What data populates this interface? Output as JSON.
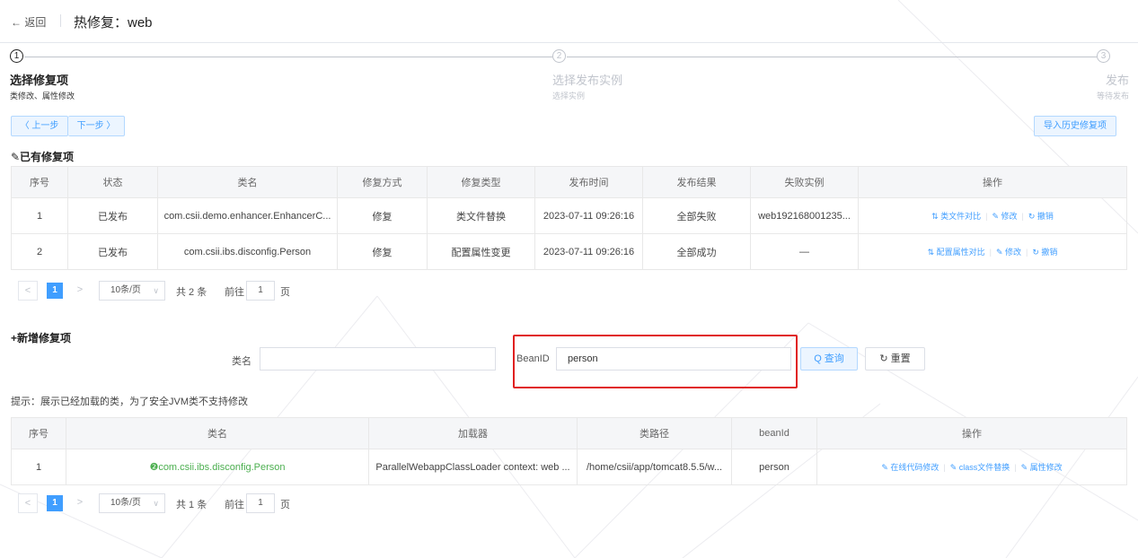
{
  "header": {
    "back_label": "← 返回",
    "title": "热修复：web"
  },
  "steps": [
    {
      "num": "1",
      "title": "选择修复项",
      "desc": "类修改、属性修改"
    },
    {
      "num": "2",
      "title": "选择发布实例",
      "desc": "选择实例"
    },
    {
      "num": "3",
      "title": "发布",
      "desc": "等待发布"
    }
  ],
  "nav": {
    "prev_label": "〈 上一步",
    "next_label": "下一步 〉",
    "import_label": "导入历史修复项"
  },
  "existing": {
    "title": "✎已有修复项",
    "columns": [
      "序号",
      "状态",
      "类名",
      "修复方式",
      "修复类型",
      "发布时间",
      "发布结果",
      "失败实例",
      "操作"
    ],
    "rows": [
      {
        "idx": "1",
        "status": "已发布",
        "class": "com.csii.demo.enhancer.EnhancerC...",
        "method": "修复",
        "type": "类文件替换",
        "time": "2023-07-11 09:26:16",
        "result": "全部失败",
        "failed": "web192168001235...",
        "op1": "⇅ 类文件对比",
        "op2": "✎ 修改",
        "op3": "↻ 撤销"
      },
      {
        "idx": "2",
        "status": "已发布",
        "class": "com.csii.ibs.disconfig.Person",
        "method": "修复",
        "type": "配置属性变更",
        "time": "2023-07-11 09:26:16",
        "result": "全部成功",
        "failed": "—",
        "op1": "⇅ 配置属性对比",
        "op2": "✎ 修改",
        "op3": "↻ 撤销"
      }
    ],
    "pager": {
      "prev": "<",
      "current": "1",
      "next": ">",
      "size": "10条/页",
      "caret": "∨",
      "total": "共 2 条",
      "goto": "前往",
      "page": "1",
      "unit": "页"
    }
  },
  "add": {
    "title": "+新增修复项",
    "class_label": "类名",
    "class_value": "",
    "bean_label": "BeanID",
    "bean_value": "person",
    "search_label": "Q 查询",
    "reset_label": "↻ 重置"
  },
  "hint": "提示：展示已经加载的类，为了安全JVM类不支持修改",
  "loaded": {
    "columns": [
      "序号",
      "类名",
      "加载器",
      "类路径",
      "beanId",
      "操作"
    ],
    "rows": [
      {
        "idx": "1",
        "class": "❷com.csii.ibs.disconfig.Person",
        "loader": "ParallelWebappClassLoader context: web ...",
        "path": "/home/csii/app/tomcat8.5.5/w...",
        "bean": "person",
        "op1": "✎ 在线代码修改",
        "op2": "✎ class文件替换",
        "op3": "✎ 属性修改"
      }
    ],
    "pager": {
      "prev": "<",
      "current": "1",
      "next": ">",
      "size": "10条/页",
      "caret": "∨",
      "total": "共 1 条",
      "goto": "前往",
      "page": "1",
      "unit": "页"
    }
  },
  "colors": {
    "accent": "#409eff",
    "highlight_box": "#e02020",
    "class_link": "#4caf50"
  }
}
